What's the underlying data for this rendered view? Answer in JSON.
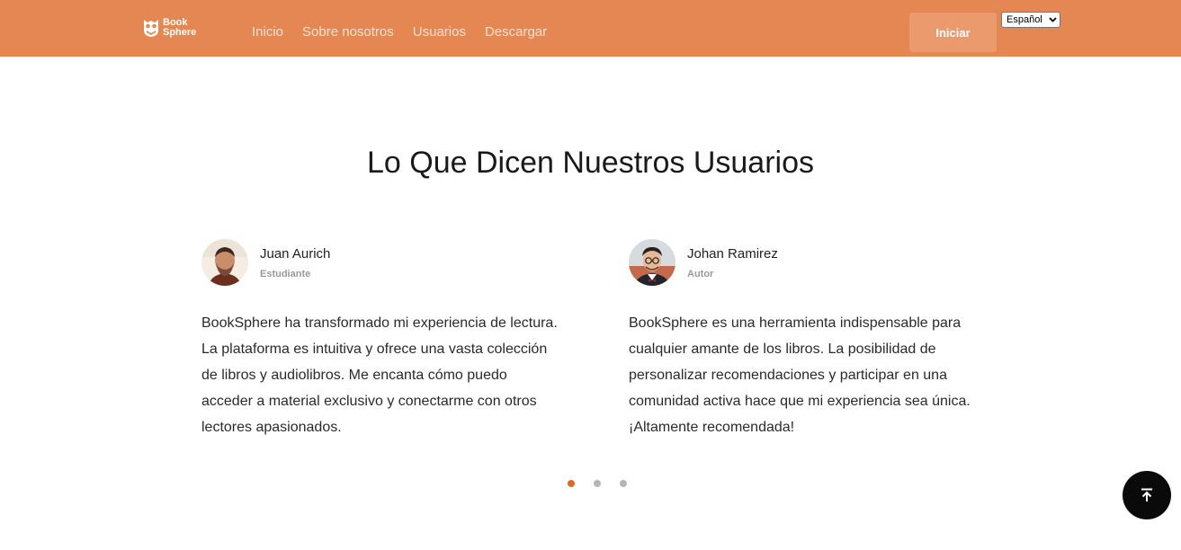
{
  "brand": {
    "line1": "Book",
    "line2": "Sphere",
    "icon": "owl-logo-icon"
  },
  "nav": {
    "links": [
      "Inicio",
      "Sobre nosotros",
      "Usuarios",
      "Descargar"
    ],
    "login_label": "Iniciar",
    "language": {
      "selected": "Español",
      "icon": "chevron-down-icon"
    }
  },
  "colors": {
    "header_bg": "#e58752",
    "accent": "#e2691f",
    "dark": "#0a0a0a"
  },
  "section": {
    "title": "Lo Que Dicen Nuestros Usuarios"
  },
  "testimonials": [
    {
      "name": "Juan Aurich",
      "role": "Estudiante",
      "text": "BookSphere ha transformado mi experiencia de lectura. La plataforma es intuitiva y ofrece una vasta colección de libros y audiolibros. Me encanta cómo puedo acceder a material exclusivo y conectarme con otros lectores apasionados."
    },
    {
      "name": "Johan Ramirez",
      "role": "Autor",
      "text": "BookSphere es una herramienta indispensable para cualquier amante de los libros. La posibilidad de personalizar recomendaciones y participar en una comunidad activa hace que mi experiencia sea única. ¡Altamente recomendada!"
    }
  ],
  "carousel": {
    "pages": 3,
    "active": 1
  },
  "scroll_top": {
    "icon": "arrow-up-to-top-icon"
  }
}
